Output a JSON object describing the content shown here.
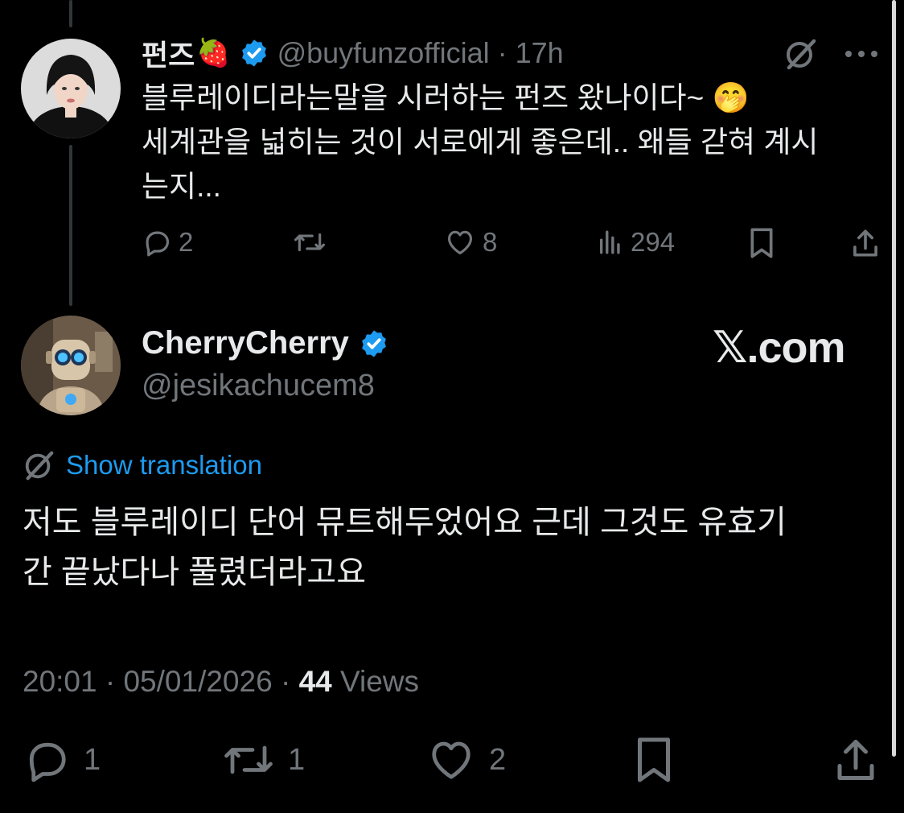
{
  "parent_tweet": {
    "display_name": "펀즈",
    "name_emoji": "🍓",
    "handle": "@buyfunzofficial",
    "separator": "·",
    "time": "17h",
    "text_line1": "블루레이디라는말을 시러하는 펀즈 왔나이다~ 🤭",
    "text_line2": "세계관을 넓히는 것이 서로에게 좋은데.. 왜들 갇혀 계시",
    "text_line3": "는지...",
    "replies": "2",
    "retweets": "",
    "likes": "8",
    "views": "294",
    "icons": [
      "grok-icon",
      "more-icon",
      "reply-icon",
      "retweet-icon",
      "like-icon",
      "views-icon",
      "bookmark-icon",
      "share-icon"
    ]
  },
  "main_tweet": {
    "display_name": "CherryCherry",
    "handle": "@jesikachucem8",
    "brand": "𝕏.com",
    "translate_label": "Show translation",
    "text_line1": "저도 블루레이디 단어 뮤트해두었어요 근데 그것도 유효기",
    "text_line2": "간 끝났다나 풀렸더라고요",
    "time": "20:01",
    "date": "05/01/2026",
    "separator": "·",
    "views_count": "44",
    "views_label": "Views",
    "replies": "1",
    "retweets": "1",
    "likes": "2",
    "icons": [
      "reply-icon",
      "retweet-icon",
      "like-icon",
      "bookmark-icon",
      "share-icon"
    ]
  },
  "colors": {
    "background": "#000000",
    "text": "#e7e9ea",
    "muted": "#71767b",
    "accent": "#1d9bf0",
    "thread_line": "#333639"
  }
}
